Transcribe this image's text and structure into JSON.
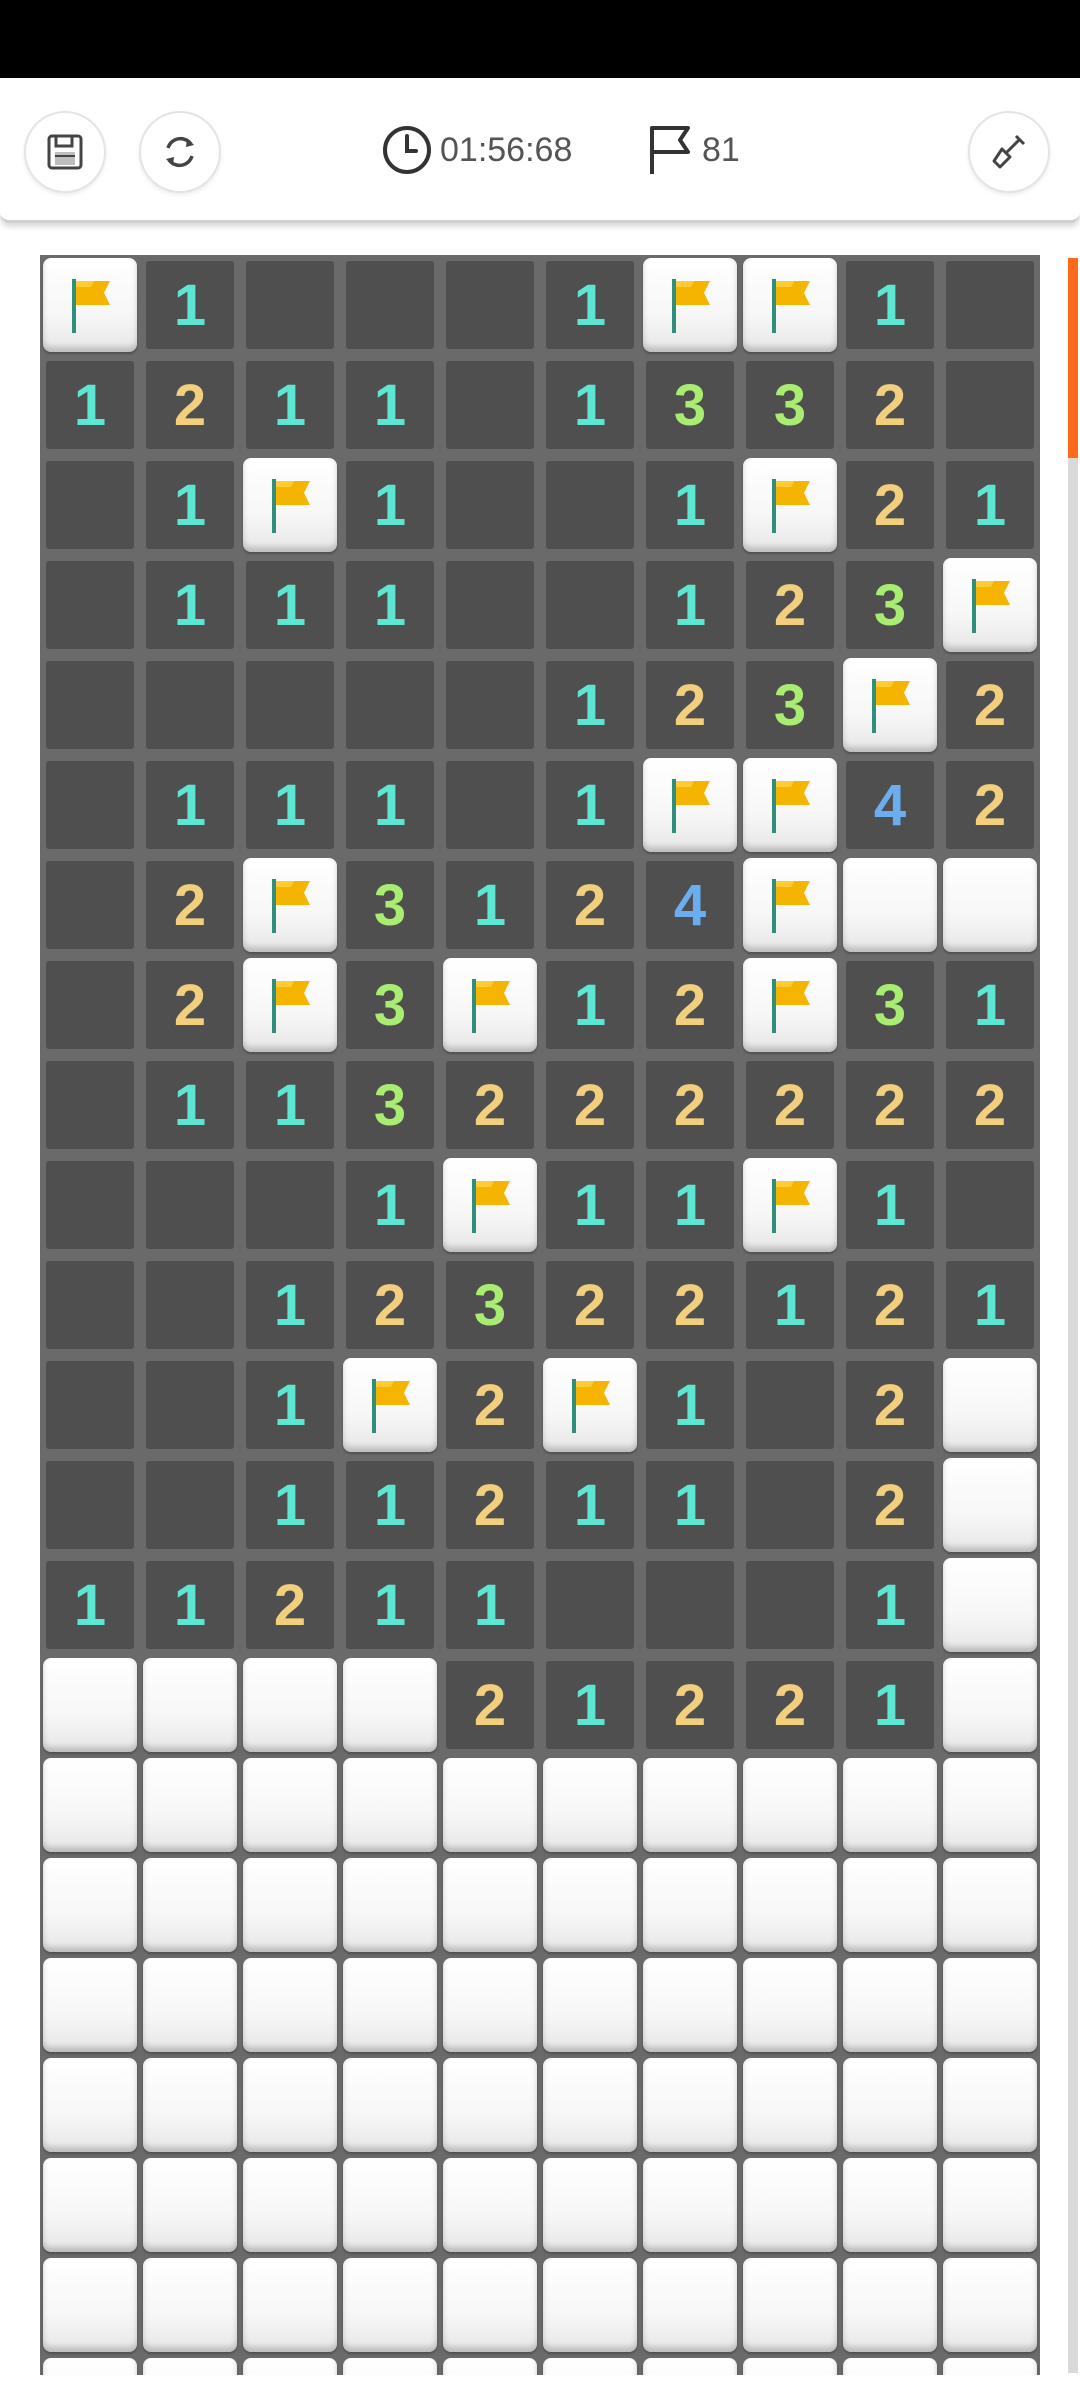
{
  "timer": {
    "value": "01:56:68"
  },
  "flags": {
    "count": "81"
  },
  "toolbar_icons": [
    "save-icon",
    "restart-icon",
    "clock-icon",
    "flag-icon",
    "shovel-icon"
  ],
  "colors": {
    "n1": "#5de7d3",
    "n2": "#f1cf7c",
    "n3": "#a9ec72",
    "n4": "#6aaef0",
    "flag": "#f4b400",
    "accent": "#ff6a1a"
  },
  "board": {
    "columns": 10,
    "rows": [
      "F1  .1FF1.",
      "1211.1332.",
      ".1F1..1F21",
      ".111..123F",
      ".....123F2",
      ".111.1FF42",
      ".2F3124F##",
      ".2F3F12F31",
      ".113222222",
      "...1F11F1.",
      "..12322121",
      "..1F2F1.2#",
      "..11211.2#",
      "11211...1#",
      "####21221#",
      "##########",
      "##########",
      "##########",
      "##########",
      "##########",
      "##########",
      "##########"
    ]
  }
}
